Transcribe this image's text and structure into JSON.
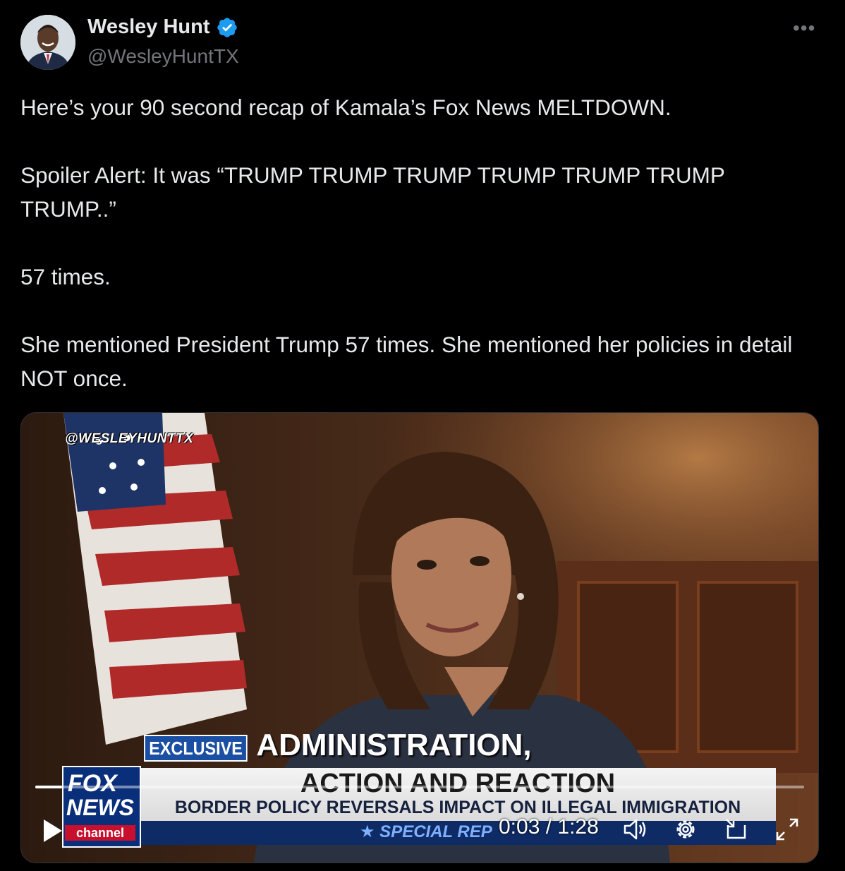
{
  "author": {
    "name": "Wesley Hunt",
    "handle": "@WesleyHuntTX",
    "verified_color": "#1d9bf0"
  },
  "tweet": {
    "paragraphs": [
      "Here’s your 90 second recap of Kamala’s Fox News MELTDOWN.",
      "Spoiler Alert: It was “TRUMP TRUMP TRUMP TRUMP TRUMP TRUMP TRUMP..”",
      "57 times.",
      "She mentioned President Trump 57 times.  She mentioned her policies in detail NOT once."
    ]
  },
  "video": {
    "watermark": "@WESLEYHUNTTX",
    "chyron": {
      "tag": "EXCLUSIVE",
      "headline": "ADMINISTRATION,",
      "line1": "ACTION AND REACTION",
      "line2": "BORDER POLICY REVERSALS IMPACT ON ILLEGAL IMMIGRATION",
      "special": "★ SPECIAL REP"
    },
    "logo": {
      "fox": "FOX",
      "news": "NEWS",
      "channel": "channel"
    },
    "player": {
      "time": "0:03 / 1:28",
      "progress_fraction": 0.035
    }
  },
  "icons": {
    "more": "more-icon",
    "verified": "verified-badge-icon",
    "play": "play-icon",
    "volume": "volume-icon",
    "settings": "gear-icon",
    "pip": "picture-in-picture-icon",
    "fullscreen": "fullscreen-icon"
  }
}
